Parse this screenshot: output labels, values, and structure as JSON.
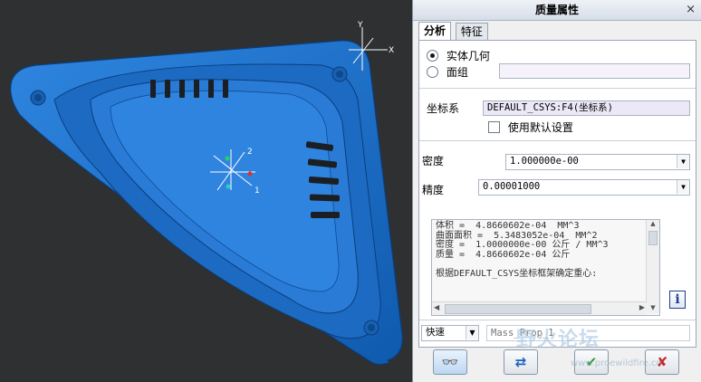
{
  "dialog": {
    "title": "质量属性",
    "close_glyph": "×",
    "tabs": [
      {
        "label": "分析",
        "active": true
      },
      {
        "label": "特征",
        "active": false
      }
    ],
    "geometry_options": [
      {
        "label": "实体几何",
        "selected": true
      },
      {
        "label": "面组",
        "selected": false
      }
    ],
    "coord_label": "坐标系",
    "coord_value": "DEFAULT_CSYS:F4(坐标系)",
    "use_default_label": "使用默认设置",
    "use_default_checked": false,
    "density_label": "密度",
    "density_value": "1.000000e-00",
    "precision_label": "精度",
    "precision_value": "0.00001000",
    "results": [
      "体积 =  4.8660602e-04  MM^3",
      "曲面面积 =  5.3483052e-04  MM^2",
      "密度 =  1.0000000e-00 公斤 / MM^3",
      "质量 =  4.8660602e-04 公斤",
      "",
      "根据DEFAULT_CSYS坐标框架确定重心:"
    ],
    "mode_value": "快速",
    "name_placeholder": "Mass_Prop_1",
    "info_icon": "info-icon",
    "buttons": [
      {
        "name": "preview-button",
        "icon": "glasses-icon",
        "glyph": "👓"
      },
      {
        "name": "repeat-button",
        "icon": "refresh-icon",
        "glyph": "⇄"
      },
      {
        "name": "ok-button",
        "icon": "checkmark-icon",
        "glyph": "✔"
      },
      {
        "name": "cancel-button",
        "icon": "cancel-icon",
        "glyph": "✘"
      }
    ]
  },
  "viewport": {
    "model_color": "#1f6fc9",
    "axis_labels": {
      "x": "X",
      "y": "Y"
    },
    "csys_labels": [
      "2",
      "1"
    ]
  },
  "watermark": {
    "text": "野火论坛",
    "url": "www.proewildfire.cn"
  }
}
